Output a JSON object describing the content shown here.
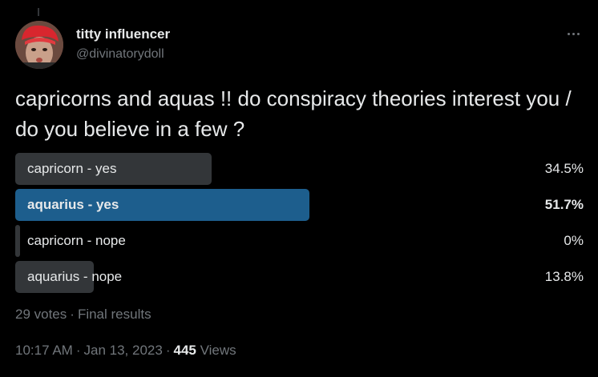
{
  "tweet": {
    "author": {
      "display_name": "titty influencer",
      "handle": "@divinatorydoll"
    },
    "text": "capricorns and aquas !! do conspiracy theories interest you / do you believe in a few ?",
    "poll": {
      "options": [
        {
          "label": "capricorn - yes",
          "percent_text": "34.5%",
          "fraction": 0.345,
          "winner": false
        },
        {
          "label": "aquarius - yes",
          "percent_text": "51.7%",
          "fraction": 0.517,
          "winner": true
        },
        {
          "label": "capricorn - nope",
          "percent_text": "0%",
          "fraction": 0.0,
          "winner": false
        },
        {
          "label": "aquarius - nope",
          "percent_text": "13.8%",
          "fraction": 0.138,
          "winner": false
        }
      ],
      "votes": "29 votes",
      "status": "Final results"
    },
    "meta": {
      "time": "10:17 AM",
      "date": "Jan 13, 2023",
      "views_count": "445",
      "views_label": "Views"
    }
  },
  "colors": {
    "background": "#000000",
    "winner_bar": "#1d5e8d",
    "bar": "#333639",
    "secondary_text": "#71767b"
  },
  "icons": {
    "more": "more-horizontal-icon"
  }
}
